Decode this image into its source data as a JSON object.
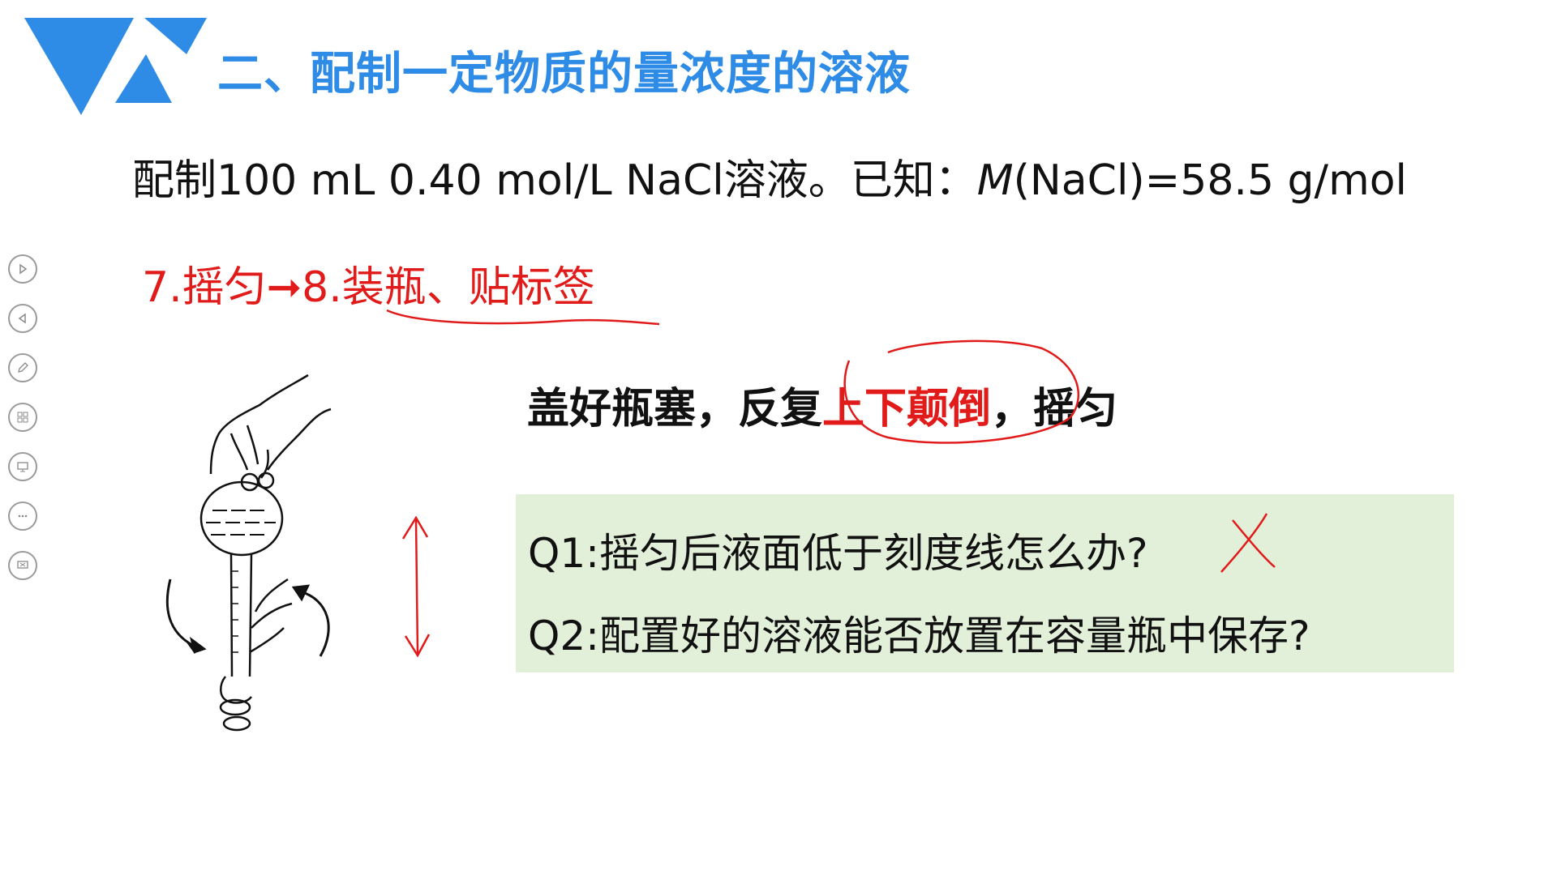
{
  "header": {
    "title": "二、配制一定物质的量浓度的溶液"
  },
  "problem": {
    "prefix": "配制100 mL 0.40 mol/L NaCl溶液。已知：",
    "molar_symbol": "M",
    "suffix": "(NaCl)=58.5 g/mol"
  },
  "step": {
    "text": "7.摇匀➞8.装瓶、贴标签"
  },
  "instruction": {
    "part1": "盖好瓶塞，反复",
    "highlight": "上下颠倒",
    "part2": "，摇匀"
  },
  "questions": {
    "q1": "Q1:摇匀后液面低于刻度线怎么办?",
    "q2": "Q2:配置好的溶液能否放置在容量瓶中保存?"
  },
  "toolbar": {
    "icons": [
      "play-next-icon",
      "play-prev-icon",
      "pen-icon",
      "grid-icon",
      "screen-icon",
      "more-icon",
      "exit-icon"
    ]
  },
  "colors": {
    "title": "#2e8ce6",
    "accent_red": "#e11a1a",
    "box_bg": "#e2efd9"
  }
}
